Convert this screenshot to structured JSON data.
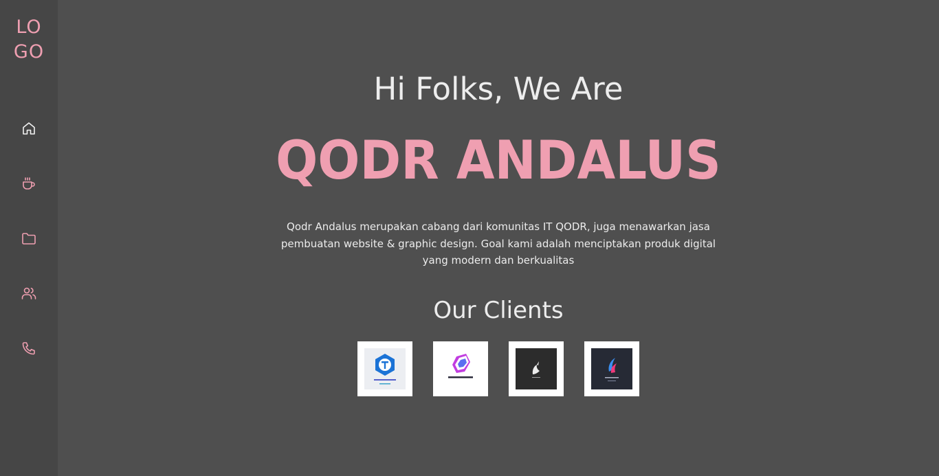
{
  "sidebar": {
    "logo_line1": "LO",
    "logo_line2": "GO",
    "nav": [
      {
        "icon": "home-icon",
        "label": "Home"
      },
      {
        "icon": "coffee-icon",
        "label": "About"
      },
      {
        "icon": "folder-icon",
        "label": "Portfolio"
      },
      {
        "icon": "users-icon",
        "label": "Team"
      },
      {
        "icon": "phone-icon",
        "label": "Contact"
      }
    ]
  },
  "hero": {
    "greeting": "Hi Folks, We Are",
    "brand": "QODR ANDALUS",
    "description": "Qodr Andalus merupakan cabang dari komunitas IT QODR, juga menawarkan jasa pembuatan website & graphic design. Goal kami adalah menciptakan produk digital yang modern dan berkualitas"
  },
  "clients": {
    "title": "Our Clients",
    "logos": [
      "client-logo-1",
      "client-logo-2",
      "client-logo-3",
      "client-logo-4"
    ]
  },
  "colors": {
    "accent": "#ef9fb1",
    "background": "#4f4f4f",
    "sidebar": "#464646",
    "text": "#ececec"
  }
}
